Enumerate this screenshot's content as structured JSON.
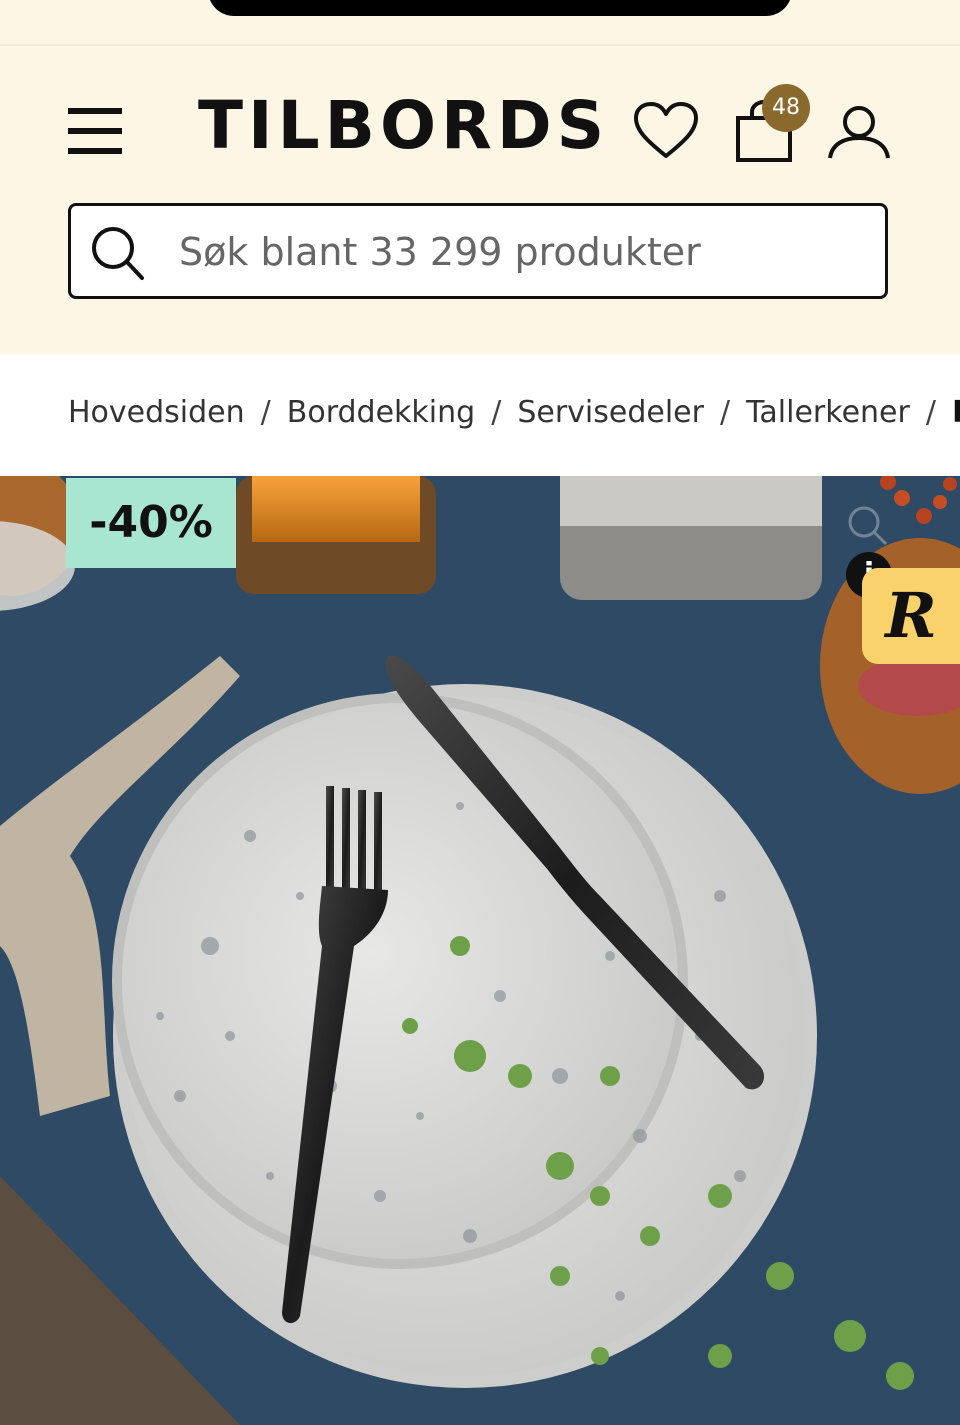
{
  "header": {
    "logo_text": "TILBORDS",
    "cart_count": "48",
    "search_placeholder": "Søk blant 33 299 produkter"
  },
  "breadcrumb": {
    "items": [
      "Hovedsiden",
      "Borddekking",
      "Servisedeler",
      "Tallerkener"
    ],
    "current": "R",
    "separator": "/"
  },
  "product": {
    "discount_label": "-40%",
    "info_label": "i",
    "review_badge_label": "R"
  },
  "colors": {
    "header_bg": "#fdf6e4",
    "cart_badge": "#8a6a2c",
    "discount_bg": "#a9e6d2",
    "review_badge_bg": "#f9d26b",
    "table_blue": "#2e4a66"
  },
  "icons": [
    "menu-icon",
    "heart-icon",
    "bag-icon",
    "user-icon",
    "search-icon",
    "zoom-icon",
    "info-icon"
  ]
}
